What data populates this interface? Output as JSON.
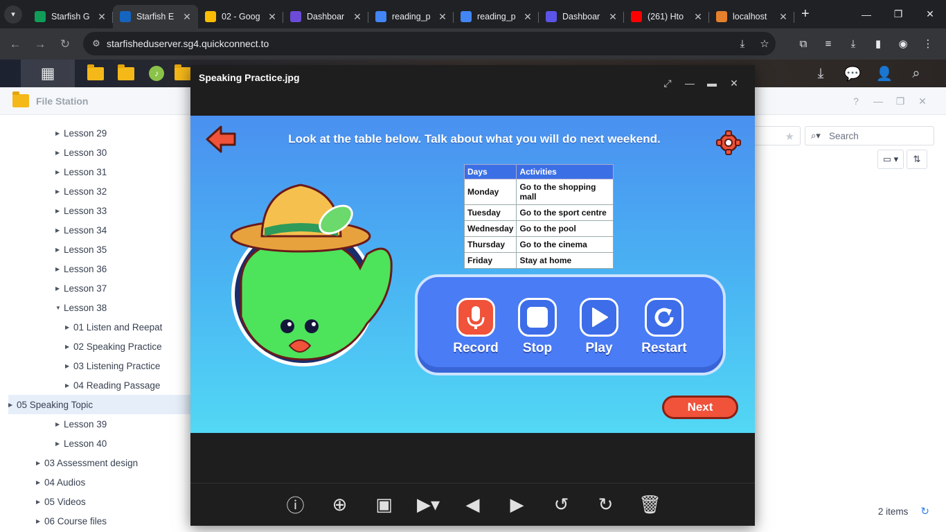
{
  "browser": {
    "tabs": [
      {
        "title": "Starfish G",
        "icon": "sheets-icon",
        "color": "#0f9d58",
        "active": false
      },
      {
        "title": "Starfish E",
        "icon": "dsm-icon",
        "color": "#1565c0",
        "active": true
      },
      {
        "title": "02 - Goog",
        "icon": "drive-icon",
        "color": "#fbbc04",
        "active": false
      },
      {
        "title": "Dashboar",
        "icon": "h-logo-icon",
        "color": "#6b4bd8",
        "active": false
      },
      {
        "title": "reading_p",
        "icon": "globe-icon",
        "color": "#4285f4",
        "active": false
      },
      {
        "title": "reading_p",
        "icon": "globe-icon",
        "color": "#4285f4",
        "active": false
      },
      {
        "title": "Dashboar",
        "icon": "l-logo-icon",
        "color": "#5b54e8",
        "active": false
      },
      {
        "title": "(261) Hto",
        "icon": "youtube-icon",
        "color": "#ff0000",
        "active": false
      },
      {
        "title": "localhost",
        "icon": "localhost-icon",
        "color": "#e5812d",
        "active": false
      }
    ],
    "new_tab": "+",
    "url": "starfisheduserver.sg4.quickconnect.to"
  },
  "file_station": {
    "title": "File Station",
    "tree": [
      {
        "label": "Lesson 29",
        "level": "lv2",
        "caret": "▶"
      },
      {
        "label": "Lesson 30",
        "level": "lv2",
        "caret": "▶"
      },
      {
        "label": "Lesson 31",
        "level": "lv2",
        "caret": "▶"
      },
      {
        "label": "Lesson 32",
        "level": "lv2",
        "caret": "▶"
      },
      {
        "label": "Lesson 33",
        "level": "lv2",
        "caret": "▶"
      },
      {
        "label": "Lesson 34",
        "level": "lv2",
        "caret": "▶"
      },
      {
        "label": "Lesson 35",
        "level": "lv2",
        "caret": "▶"
      },
      {
        "label": "Lesson 36",
        "level": "lv2",
        "caret": "▶"
      },
      {
        "label": "Lesson 37",
        "level": "lv2",
        "caret": "▶"
      },
      {
        "label": "Lesson 38",
        "level": "lv2",
        "caret": "▼"
      },
      {
        "label": "01 Listen and Reepat",
        "level": "lv3",
        "caret": "▶"
      },
      {
        "label": "02 Speaking Practice",
        "level": "lv3",
        "caret": "▶"
      },
      {
        "label": "03 Listening Practice",
        "level": "lv3",
        "caret": "▶"
      },
      {
        "label": "04 Reading Passage",
        "level": "lv3",
        "caret": "▶"
      },
      {
        "label": "05 Speaking Topic",
        "level": "lv3",
        "caret": "▶",
        "selected": true
      },
      {
        "label": "Lesson 39",
        "level": "lv2",
        "caret": "▶"
      },
      {
        "label": "Lesson 40",
        "level": "lv2",
        "caret": "▶"
      },
      {
        "label": "03 Assessment design",
        "level": "lv1",
        "caret": "▶"
      },
      {
        "label": "04 Audios",
        "level": "lv1",
        "caret": "▶"
      },
      {
        "label": "05 Videos",
        "level": "lv1",
        "caret": "▶"
      },
      {
        "label": "06 Course files",
        "level": "lv1",
        "caret": "▶"
      }
    ],
    "search_placeholder": "Search",
    "status": "2 items"
  },
  "viewer": {
    "title": "Speaking Practice.jpg",
    "image": {
      "instruction": "Look at the table below. Talk about what you will do next weekend.",
      "table": {
        "headers": [
          "Days",
          "Activities"
        ],
        "rows": [
          [
            "Monday",
            "Go to the shopping mall"
          ],
          [
            "Tuesday",
            "Go to the sport centre"
          ],
          [
            "Wednesday",
            "Go to the pool"
          ],
          [
            "Thursday",
            "Go to the cinema"
          ],
          [
            "Friday",
            "Stay at home"
          ]
        ]
      },
      "controls": [
        {
          "label": "Record",
          "icon": "microphone-icon"
        },
        {
          "label": "Stop",
          "icon": "stop-icon"
        },
        {
          "label": "Play",
          "icon": "play-icon"
        },
        {
          "label": "Restart",
          "icon": "restart-icon"
        }
      ],
      "next_label": "Next"
    }
  },
  "colors": {
    "accent": "#2f80ed",
    "record_red": "#f0523a",
    "panel_blue": "#4a7cf5"
  }
}
